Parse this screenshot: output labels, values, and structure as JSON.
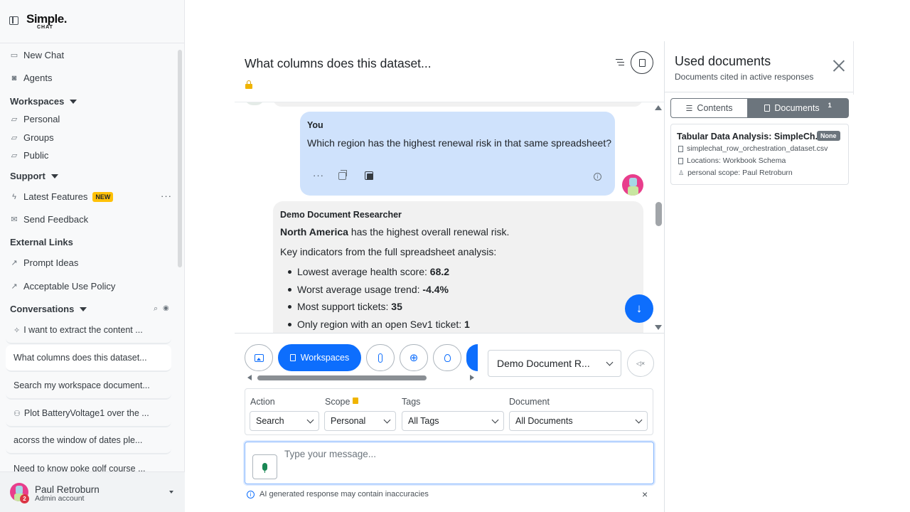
{
  "brand": {
    "title": "Simple.",
    "subtitle": "CHAT"
  },
  "sidebar": {
    "new_chat": "New Chat",
    "agents": "Agents",
    "workspaces": {
      "label": "Workspaces",
      "items": [
        "Personal",
        "Groups",
        "Public"
      ]
    },
    "support": {
      "label": "Support",
      "latest_features": "Latest Features",
      "new_badge": "NEW",
      "send_feedback": "Send Feedback"
    },
    "external": {
      "label": "External Links",
      "items": [
        "Prompt Ideas",
        "Acceptable Use Policy"
      ]
    },
    "conversations": {
      "label": "Conversations",
      "items": [
        "I want to extract the content ...",
        "What columns does this dataset...",
        "Search my workspace document...",
        "Plot BatteryVoltage1 over the ...",
        "acorss the window of dates ple...",
        "Need to know poke golf course ..."
      ]
    },
    "user": {
      "name": "Paul Retroburn",
      "role": "Admin account",
      "notifications": "2"
    }
  },
  "chat": {
    "title": "What columns does this dataset...",
    "user_message": {
      "sender": "You",
      "text": "Which region has the highest renewal risk in that same spreadsheet?"
    },
    "ai_message": {
      "sender": "Demo Document Researcher",
      "lead_bold": "North America",
      "lead_rest": " has the highest overall renewal risk.",
      "intro": "Key indicators from the full spreadsheet analysis:",
      "bullets": [
        {
          "text": "Lowest average health score: ",
          "value": "68.2"
        },
        {
          "text": "Worst average usage trend: ",
          "value": "-4.4%"
        },
        {
          "text": "Most support tickets: ",
          "value": "35"
        },
        {
          "text": "Only region with an open Sev1 ticket: ",
          "value": "1"
        }
      ]
    }
  },
  "toolbar": {
    "workspaces_label": "Workspaces",
    "agent_select": "Demo Document R..."
  },
  "filters": {
    "action": {
      "label": "Action",
      "value": "Search"
    },
    "scope": {
      "label": "Scope",
      "value": "Personal"
    },
    "tags": {
      "label": "Tags",
      "value": "All Tags"
    },
    "document": {
      "label": "Document",
      "value": "All Documents"
    }
  },
  "composer": {
    "placeholder": "Type your message...",
    "disclaimer": "AI generated response may contain inaccuracies"
  },
  "right_panel": {
    "title": "Used documents",
    "subtitle": "Documents cited in active responses",
    "tabs": {
      "contents": "Contents",
      "documents": "Documents",
      "documents_count": "1"
    },
    "doc": {
      "title": "Tabular Data Analysis: SimpleCh...",
      "badge": "None",
      "file": "simplechat_row_orchestration_dataset.csv",
      "locations": "Locations: Workbook Schema",
      "scope": "personal scope: Paul Retroburn"
    }
  },
  "colors": {
    "primary": "#0d6efd",
    "user_bubble": "#cfe2fc",
    "ai_bubble": "#f1f1f1",
    "avatar_pink": "#e83e8c"
  }
}
